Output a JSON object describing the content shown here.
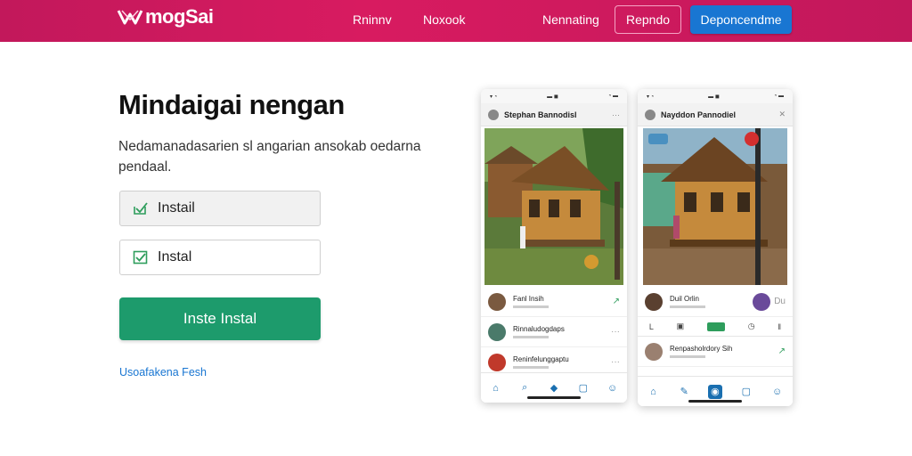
{
  "header": {
    "logo_text": "mogSai",
    "logo_subtitle": "",
    "nav_links": [
      "Rninnv",
      "Noxook",
      "Nennating"
    ],
    "outline_button": "Repndo",
    "primary_button": "Deponcendme"
  },
  "hero": {
    "title": "Mindaigai nengan",
    "description": "Nedamanadasarien sl angarian ansokab oedarna pendaal.",
    "option1": "Instail",
    "option2": "Instal",
    "install_button": "Inste Instal",
    "link": "Usoafakena Fesh"
  },
  "phone1": {
    "header_name": "Stephan Bannodisl",
    "rows": [
      {
        "name": "Fanl Insih",
        "end": "↗"
      },
      {
        "name": "Rinnaludogdaps",
        "end": "···"
      },
      {
        "name": "Reninfelunggaptu",
        "end": "···"
      }
    ]
  },
  "phone2": {
    "header_name": "Nayddon Pannodiel",
    "rows": [
      {
        "name": "Duil Orlin",
        "end": "Du"
      },
      {
        "name": "Renpasholrdory Sih",
        "end": "↗"
      }
    ]
  },
  "colors": {
    "header_bg": "#c2185b",
    "primary": "#1976d2",
    "install": "#1d9b6c"
  }
}
